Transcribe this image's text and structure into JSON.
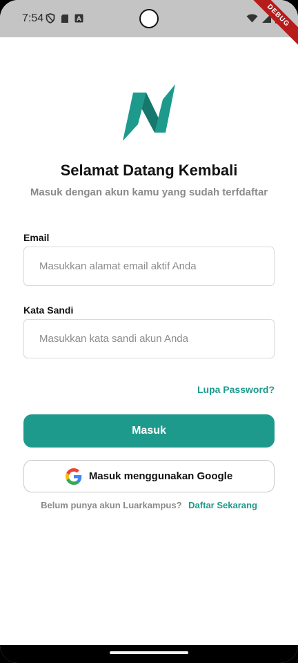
{
  "status_bar": {
    "time": "7:54",
    "icons_left": [
      "shield-icon",
      "sd-card-icon",
      "font-box-icon"
    ],
    "icons_right": [
      "wifi-icon",
      "signal-icon",
      "battery-icon"
    ],
    "debug_banner": "DEBUG"
  },
  "logo": {
    "name": "app-logo",
    "colors": [
      "#1e9a8c",
      "#16776c"
    ]
  },
  "header": {
    "title": "Selamat Datang Kembali",
    "subtitle": "Masuk dengan akun kamu yang sudah terfdaftar"
  },
  "form": {
    "email_label": "Email",
    "email_placeholder": "Masukkan alamat email aktif Anda",
    "email_value": "",
    "password_label": "Kata Sandi",
    "password_placeholder": "Masukkan kata sandi akun Anda",
    "password_value": "",
    "forgot_label": "Lupa Password?"
  },
  "actions": {
    "login_label": "Masuk",
    "google_label": "Masuk menggunakan Google"
  },
  "footer": {
    "prompt": "Belum punya akun Luarkampus?",
    "register_label": "Daftar Sekarang"
  },
  "colors": {
    "accent": "#1e9a8c",
    "status_bar": "#c4c4c4",
    "muted_text": "#8a8a8a",
    "debug_banner": "#b71c1c"
  }
}
